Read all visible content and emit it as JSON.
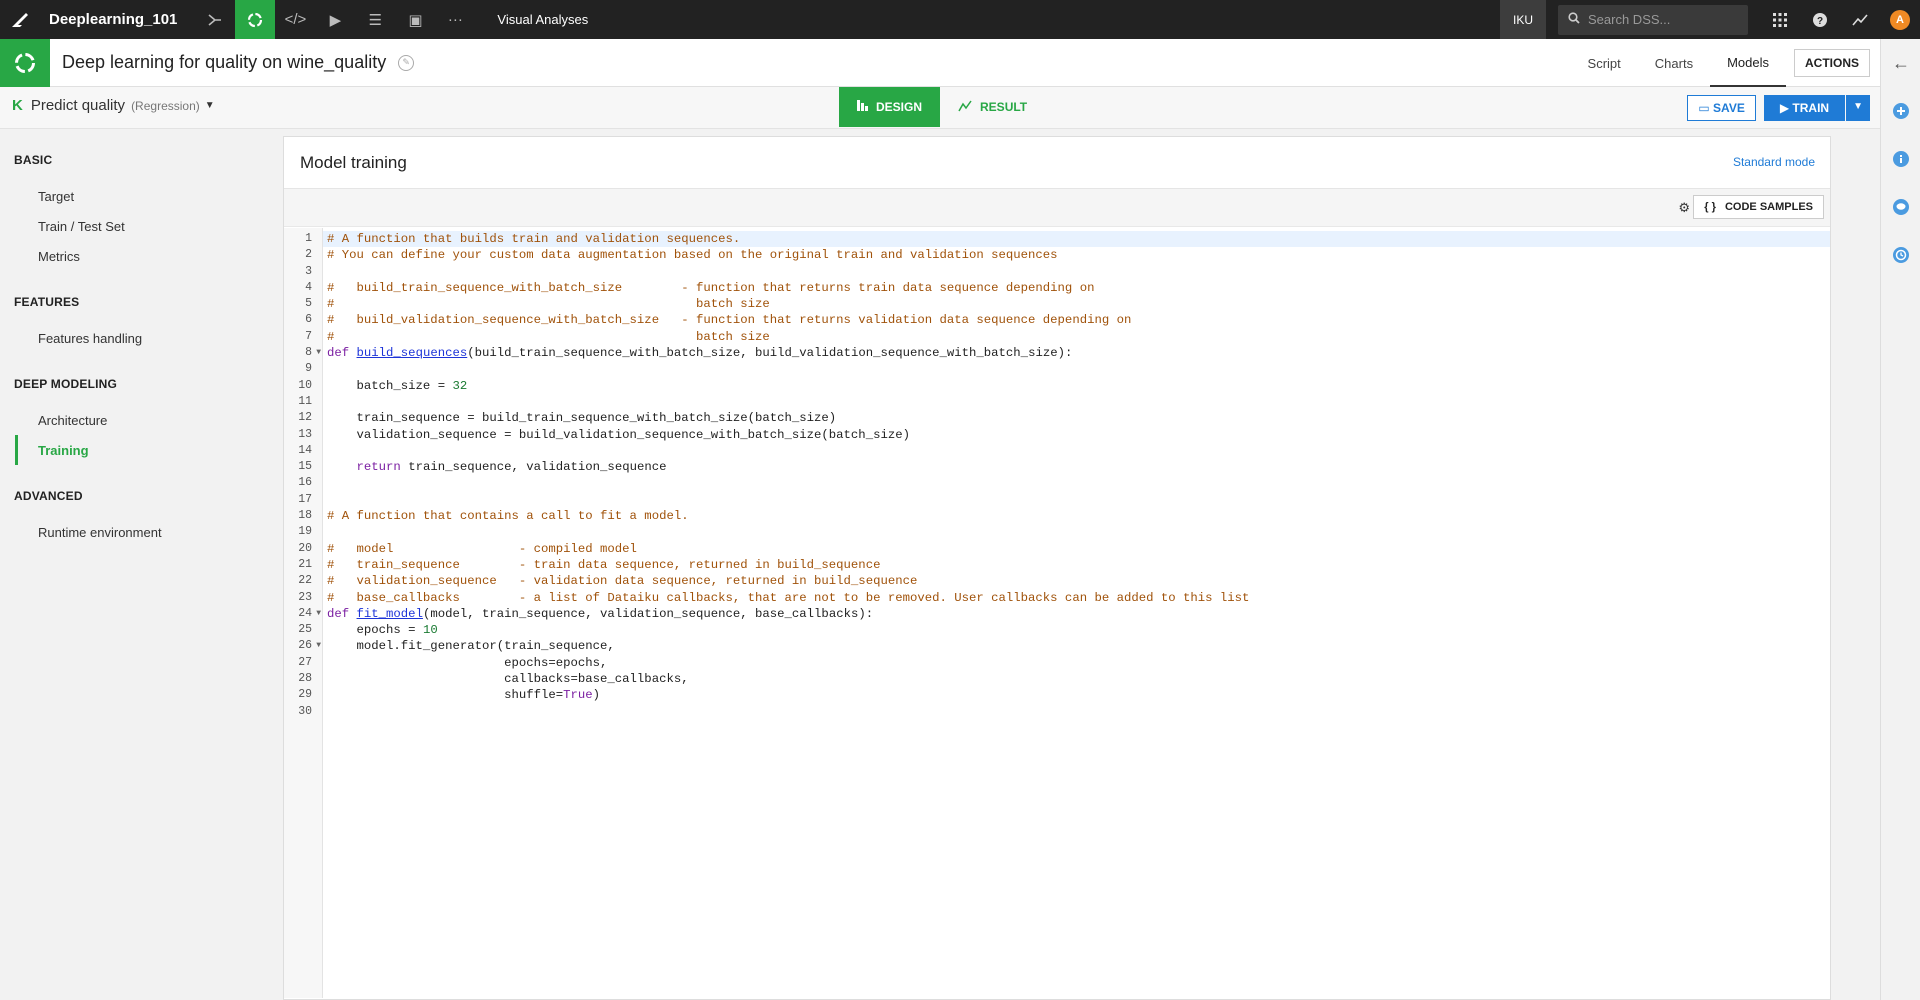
{
  "topbar": {
    "project": "Deeplearning_101",
    "section": "Visual Analyses",
    "instance": "IKU",
    "search_placeholder": "Search DSS...",
    "avatar": "A",
    "icons": [
      "flow-icon",
      "lab-icon",
      "code-icon",
      "run-icon",
      "stack-icon",
      "dashboard-icon",
      "more-icon"
    ]
  },
  "header": {
    "title": "Deep learning for quality on wine_quality",
    "tabs": [
      "Script",
      "Charts",
      "Models"
    ],
    "active_tab": "Models",
    "actions": "ACTIONS"
  },
  "subheader": {
    "k": "K",
    "task": "Predict quality",
    "task_type": "(Regression)",
    "design": "DESIGN",
    "result": "RESULT",
    "save": "SAVE",
    "train": "TRAIN"
  },
  "sidebar": {
    "sections": [
      {
        "title": "BASIC",
        "items": [
          "Target",
          "Train / Test Set",
          "Metrics"
        ]
      },
      {
        "title": "FEATURES",
        "items": [
          "Features handling"
        ]
      },
      {
        "title": "DEEP MODELING",
        "items": [
          "Architecture",
          "Training"
        ]
      },
      {
        "title": "ADVANCED",
        "items": [
          "Runtime environment"
        ]
      }
    ],
    "active": "Training"
  },
  "panel": {
    "title": "Model training",
    "mode_link": "Standard mode",
    "code_samples": "CODE SAMPLES"
  },
  "editor": {
    "lines": [
      "# A function that builds train and validation sequences.",
      "# You can define your custom data augmentation based on the original train and validation sequences",
      "",
      "#   build_train_sequence_with_batch_size        - function that returns train data sequence depending on",
      "#                                                 batch size",
      "#   build_validation_sequence_with_batch_size   - function that returns validation data sequence depending on",
      "#                                                 batch size",
      "def build_sequences(build_train_sequence_with_batch_size, build_validation_sequence_with_batch_size):",
      "",
      "    batch_size = 32",
      "",
      "    train_sequence = build_train_sequence_with_batch_size(batch_size)",
      "    validation_sequence = build_validation_sequence_with_batch_size(batch_size)",
      "",
      "    return train_sequence, validation_sequence",
      "",
      "",
      "# A function that contains a call to fit a model.",
      "",
      "#   model                 - compiled model",
      "#   train_sequence        - train data sequence, returned in build_sequence",
      "#   validation_sequence   - validation data sequence, returned in build_sequence",
      "#   base_callbacks        - a list of Dataiku callbacks, that are not to be removed. User callbacks can be added to this list",
      "def fit_model(model, train_sequence, validation_sequence, base_callbacks):",
      "    epochs = 10",
      "    model.fit_generator(train_sequence,",
      "                        epochs=epochs,",
      "                        callbacks=base_callbacks,",
      "                        shuffle=True)",
      ""
    ],
    "fold_lines": [
      8,
      24,
      26
    ]
  }
}
